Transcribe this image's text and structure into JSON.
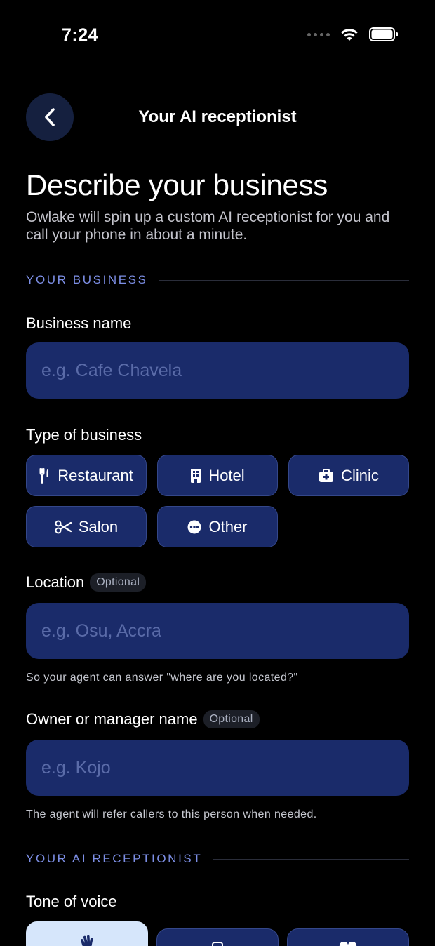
{
  "status": {
    "time": "7:24"
  },
  "header": {
    "title": "Your AI receptionist"
  },
  "intro": {
    "title": "Describe your business",
    "subtitle": "Owlake will spin up a custom AI receptionist for you and call your phone in about a minute."
  },
  "sections": {
    "business": "YOUR BUSINESS",
    "receptionist": "YOUR AI RECEPTIONIST"
  },
  "fields": {
    "business_name": {
      "label": "Business name",
      "placeholder": "e.g. Cafe Chavela"
    },
    "business_type": {
      "label": "Type of business",
      "options": [
        {
          "label": "Restaurant",
          "icon": "utensils-icon"
        },
        {
          "label": "Hotel",
          "icon": "building-icon"
        },
        {
          "label": "Clinic",
          "icon": "medical-kit-icon"
        },
        {
          "label": "Salon",
          "icon": "scissors-icon"
        },
        {
          "label": "Other",
          "icon": "more-dots-icon"
        }
      ]
    },
    "location": {
      "label": "Location",
      "badge": "Optional",
      "placeholder": "e.g. Osu, Accra",
      "helper": "So your agent can answer \"where are you located?\""
    },
    "owner": {
      "label": "Owner or manager name",
      "badge": "Optional",
      "placeholder": "e.g. Kojo",
      "helper": "The agent will refer callers to this person when needed."
    },
    "tone": {
      "label": "Tone of voice",
      "options": [
        {
          "icon": "waving-hand-icon",
          "selected": true
        },
        {
          "icon": "phone-icon",
          "selected": false
        },
        {
          "icon": "heart-icon",
          "selected": false
        }
      ]
    }
  },
  "colors": {
    "background": "#000000",
    "input_fill": "#1a2b6a",
    "accent_label": "#7d8fe6",
    "selected_card": "#d6e6fb"
  }
}
